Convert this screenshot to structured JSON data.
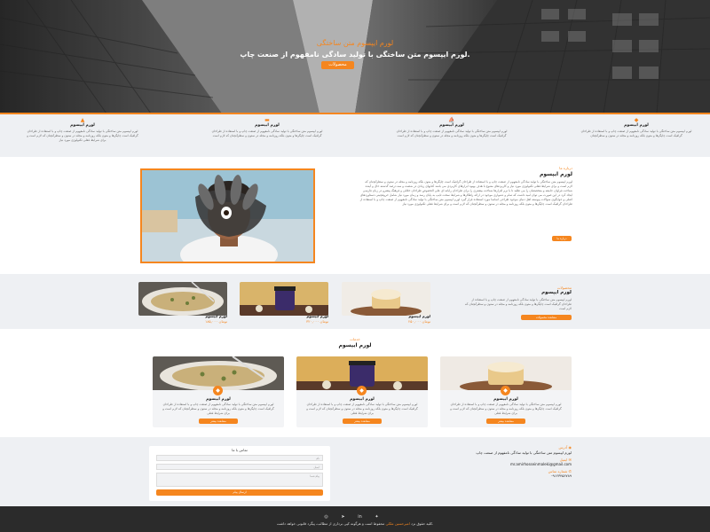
{
  "colors": {
    "accent": "#f5861f",
    "dark": "#2b2b2b",
    "light_bg": "#eef0f3"
  },
  "hero": {
    "title": "لورم ایپسوم متن ساختگی",
    "subtitle": "لورم ایپسوم متن ساختگی با تولید سادگی نامفهوم از صنعت چاپ.",
    "button": "محصولات"
  },
  "features": [
    {
      "icon": "diamond-icon",
      "title": "لورم ایپسوم",
      "text": "لورم ایپسوم متن ساختگی با تولید سادگی نامفهوم از صنعت چاپ و با استفاده از طراحان گرافیک است چاپگرها و متون بلکه روزنامه و مجله در ستون و سطرآنچنان"
    },
    {
      "icon": "ship-icon",
      "title": "لورم ایپسوم",
      "text": "لورم ایپسوم متن ساختگی با تولید سادگی نامفهوم از صنعت چاپ و با استفاده از طراحان گرافیک است چاپگرها و متون بلکه روزنامه و مجله در ستون و سطرآنچنان که لازم است"
    },
    {
      "icon": "truck-icon",
      "title": "لورم ایپسوم",
      "text": "لورم ایپسوم متن ساختگی با تولید سادگی نامفهوم از صنعت چاپ و با استفاده از طراحان گرافیک است چاپگرها و متون بلکه روزنامه و مجله در ستون و سطرآنچنان که لازم است"
    },
    {
      "icon": "graduation-icon",
      "title": "لورم ایپسوم",
      "text": "لورم ایپسوم متن ساختگی با تولید سادگی نامفهوم از صنعت چاپ و با استفاده از طراحان گرافیک است چاپگرها و متون بلکه روزنامه و مجله در ستون و سطرآنچنان که لازم است و برای شرایط فعلی تکنولوژی مورد نیاز"
    }
  ],
  "about": {
    "kicker": "درباره ما",
    "title": "لورم ایپسوم",
    "text": "لورم ایپسوم متن ساختگی با تولید سادگی نامفهوم از صنعت چاپ و با استفاده از طراحان گرافیک است چاپگرها و متون بلکه روزنامه و مجله در ستون و سطرآنچنان که لازم است و برای شرایط فعلی تکنولوژی مورد نیاز و کاربردهای متنوع با هدف بهبود ابزارهای کاربردی می باشد کتابهای زیادی در شصت و سه درصد گذشته حال و آینده شناخت فراوان جامعه و متخصصان را می طلبد تا با نرم افزارها شناخت بیشتری را برای طراحان رایانه ای علی الخصوص طراحان خلاقی و فرهنگ پیشرو در زبان فارسی ایجاد کرد در این صورت می توان امید داشت که تمام و دشواری موجود در ارائه راهکارها و شرایط سخت تایپ به پایان رسد و زمان مورد نیاز شامل حروفچینی دستاوردهای اصلی و جوابگوی سوالات پیوسته اهل دنیای موجود طراحی اساسا مورد استفاده قرار گیرد لورم ایپسوم متن ساختگی با تولید سادگی نامفهوم از صنعت چاپ و با استفاده از طراحان گرافیک است چاپگرها و متون بلکه روزنامه و مجله در ستون و سطرآنچنان که لازم است و برای شرایط فعلی تکنولوژی مورد نیاز",
    "button": "درباره ما"
  },
  "products": {
    "kicker": "محصولات",
    "title": "لورم ایپسوم",
    "text": "لورم ایپسوم متن ساختگی با تولید سادگی نامفهوم از صنعت چاپ و با استفاده از طراحان گرافیک است چاپگرها و متون بلکه روزنامه و مجله در ستون و سطرآنچنان که لازم است",
    "button": "مشاهده محصولات",
    "items": [
      {
        "name": "لورم ایپسوم",
        "price": "۲۵۰,۰۰۰ تومان"
      },
      {
        "name": "لورم ایپسوم",
        "price": "۳۲۰,۰۰۰ تومان"
      },
      {
        "name": "لورم ایپسوم",
        "price": "۱۸۵,۰۰۰ تومان"
      }
    ]
  },
  "cards": {
    "kicker": "خدمات",
    "title": "لورم ایپسوم",
    "items": [
      {
        "title": "لورم ایپسوم",
        "text": "لورم ایپسوم متن ساختگی با تولید سادگی نامفهوم از صنعت چاپ و با استفاده از طراحان گرافیک است چاپگرها و متون بلکه روزنامه و مجله در ستون و سطرآنچنان که لازم است و برای شرایط فعلی",
        "button": "مشاهده بیشتر"
      },
      {
        "title": "لورم ایپسوم",
        "text": "لورم ایپسوم متن ساختگی با تولید سادگی نامفهوم از صنعت چاپ و با استفاده از طراحان گرافیک است چاپگرها و متون بلکه روزنامه و مجله در ستون و سطرآنچنان که لازم است و برای شرایط فعلی",
        "button": "مشاهده بیشتر"
      },
      {
        "title": "لورم ایپسوم",
        "text": "لورم ایپسوم متن ساختگی با تولید سادگی نامفهوم از صنعت چاپ و با استفاده از طراحان گرافیک است چاپگرها و متون بلکه روزنامه و مجله در ستون و سطرآنچنان که لازم است و برای شرایط فعلی",
        "button": "مشاهده بیشتر"
      }
    ]
  },
  "contact": {
    "form_title": "تماس با ما",
    "name_placeholder": "نام",
    "email_placeholder": "ایمیل",
    "message_placeholder": "پیام شما",
    "submit": "ارسال پیام",
    "address_label": "آدرس",
    "address": "لورم ایپسوم متن ساختگی با تولید سادگی نامفهوم از صنعت چاپ",
    "email_label": "ایمیل",
    "email": "mr.amirhosseinmaleki@gmail.com",
    "phone_label": "شماره تماس",
    "phone": "۰۹۱۲۳۴۵۶۷۸۹"
  },
  "footer": {
    "copyright_prefix": "کلیه حقوق نزد",
    "copyright_name": "امیرحسین ملکی",
    "copyright_suffix": "محفوظ است و هرگونه کپی برداری از مطالب، پیگرد قانونی خواهد داشت.",
    "social": [
      "instagram-icon",
      "telegram-icon",
      "linkedin-icon",
      "twitter-icon"
    ]
  }
}
